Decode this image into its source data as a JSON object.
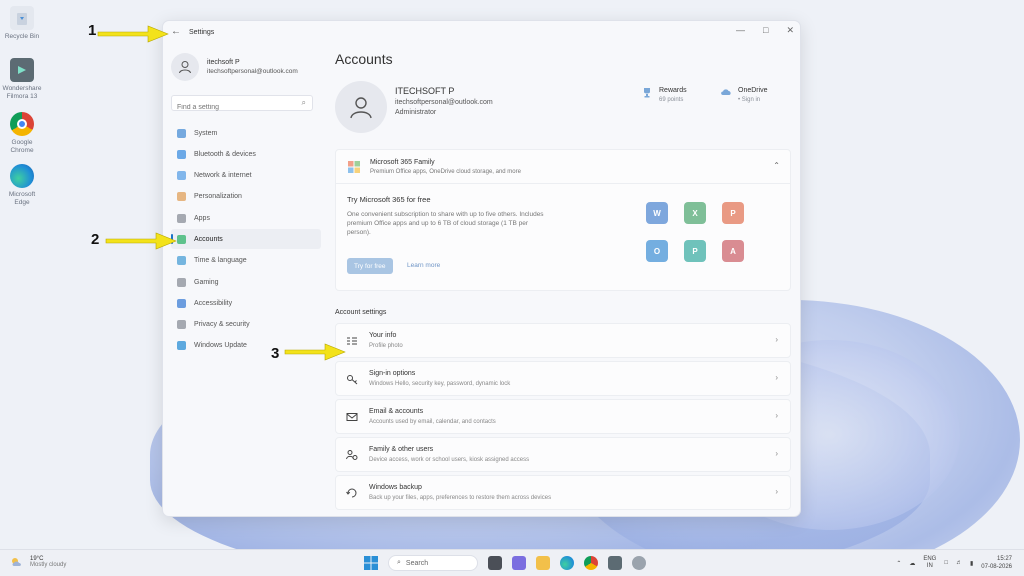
{
  "desktop": {
    "icons": [
      {
        "label": "Recycle Bin",
        "icon": "recycle-bin-icon"
      },
      {
        "label": "Wondershare Filmora 13",
        "icon": "filmora-icon"
      },
      {
        "label": "Google Chrome",
        "icon": "chrome-icon"
      },
      {
        "label": "Microsoft Edge",
        "icon": "edge-icon"
      }
    ]
  },
  "window": {
    "title": "Settings",
    "back_icon": "←",
    "controls": [
      "—",
      "□",
      "✕"
    ]
  },
  "sidebar": {
    "user_name": "itechsoft P",
    "user_email": "itechsoftpersonal@outlook.com",
    "search_placeholder": "Find a setting",
    "search_icon": "⌕",
    "items": [
      {
        "label": "System",
        "icon": "system-icon",
        "color": "#4a8fd6"
      },
      {
        "label": "Bluetooth & devices",
        "icon": "bluetooth-icon",
        "color": "#3d8fe0"
      },
      {
        "label": "Network & internet",
        "icon": "network-icon",
        "color": "#5aa0e6"
      },
      {
        "label": "Personalization",
        "icon": "brush-icon",
        "color": "#e0a05a"
      },
      {
        "label": "Apps",
        "icon": "apps-icon",
        "color": "#8a8f98"
      },
      {
        "label": "Accounts",
        "icon": "accounts-icon",
        "color": "#2fb36a"
      },
      {
        "label": "Time & language",
        "icon": "globe-icon",
        "color": "#4a9fd6"
      },
      {
        "label": "Gaming",
        "icon": "gaming-icon",
        "color": "#8a8f98"
      },
      {
        "label": "Accessibility",
        "icon": "accessibility-icon",
        "color": "#3d7fd6"
      },
      {
        "label": "Privacy & security",
        "icon": "shield-icon",
        "color": "#8a8f98"
      },
      {
        "label": "Windows Update",
        "icon": "update-icon",
        "color": "#2a8fd6"
      }
    ],
    "active_index": 5
  },
  "main": {
    "title": "Accounts",
    "account": {
      "name": "ITECHSOFT P",
      "email": "itechsoftpersonal@outlook.com",
      "role": "Administrator"
    },
    "rewards": {
      "title": "Rewards",
      "sub": "69 points"
    },
    "onedrive": {
      "title": "OneDrive",
      "sub": "• Sign in"
    },
    "m365": {
      "title": "Microsoft 365 Family",
      "sub": "Premium Office apps, OneDrive cloud storage, and more",
      "try_title": "Try Microsoft 365 for free",
      "try_desc": "One convenient subscription to share with up to five others. Includes premium Office apps and up to 6 TB of cloud storage (1 TB per person).",
      "try_button": "Try for free",
      "learn_more": "Learn more",
      "apps": [
        {
          "letter": "W",
          "name": "word-icon",
          "color": "#7ea7dd"
        },
        {
          "letter": "X",
          "name": "excel-icon",
          "color": "#7fbf98"
        },
        {
          "letter": "P",
          "name": "powerpoint-icon",
          "color": "#e99a84"
        },
        {
          "letter": "O",
          "name": "outlook-icon",
          "color": "#74aee0"
        },
        {
          "letter": "P",
          "name": "publisher-icon",
          "color": "#6fc2bb"
        },
        {
          "letter": "A",
          "name": "access-icon",
          "color": "#d98c92"
        }
      ]
    },
    "account_settings_label": "Account settings",
    "settings": [
      {
        "title": "Your info",
        "sub": "Profile photo",
        "icon": "your-info-icon"
      },
      {
        "title": "Sign-in options",
        "sub": "Windows Hello, security key, password, dynamic lock",
        "icon": "key-icon"
      },
      {
        "title": "Email & accounts",
        "sub": "Accounts used by email, calendar, and contacts",
        "icon": "mail-icon"
      },
      {
        "title": "Family & other users",
        "sub": "Device access, work or school users, kiosk assigned access",
        "icon": "family-icon"
      },
      {
        "title": "Windows backup",
        "sub": "Back up your files, apps, preferences to restore them across devices",
        "icon": "backup-icon"
      }
    ]
  },
  "annotations": {
    "labels": [
      "1",
      "2",
      "3"
    ],
    "arrow_color": "#f3e21a"
  },
  "taskbar": {
    "temperature": "19°C",
    "condition": "Mostly cloudy",
    "search_label": "Search",
    "lang_top": "ENG",
    "lang_bottom": "IN",
    "time": "15:27",
    "date": "07-08-2026"
  }
}
